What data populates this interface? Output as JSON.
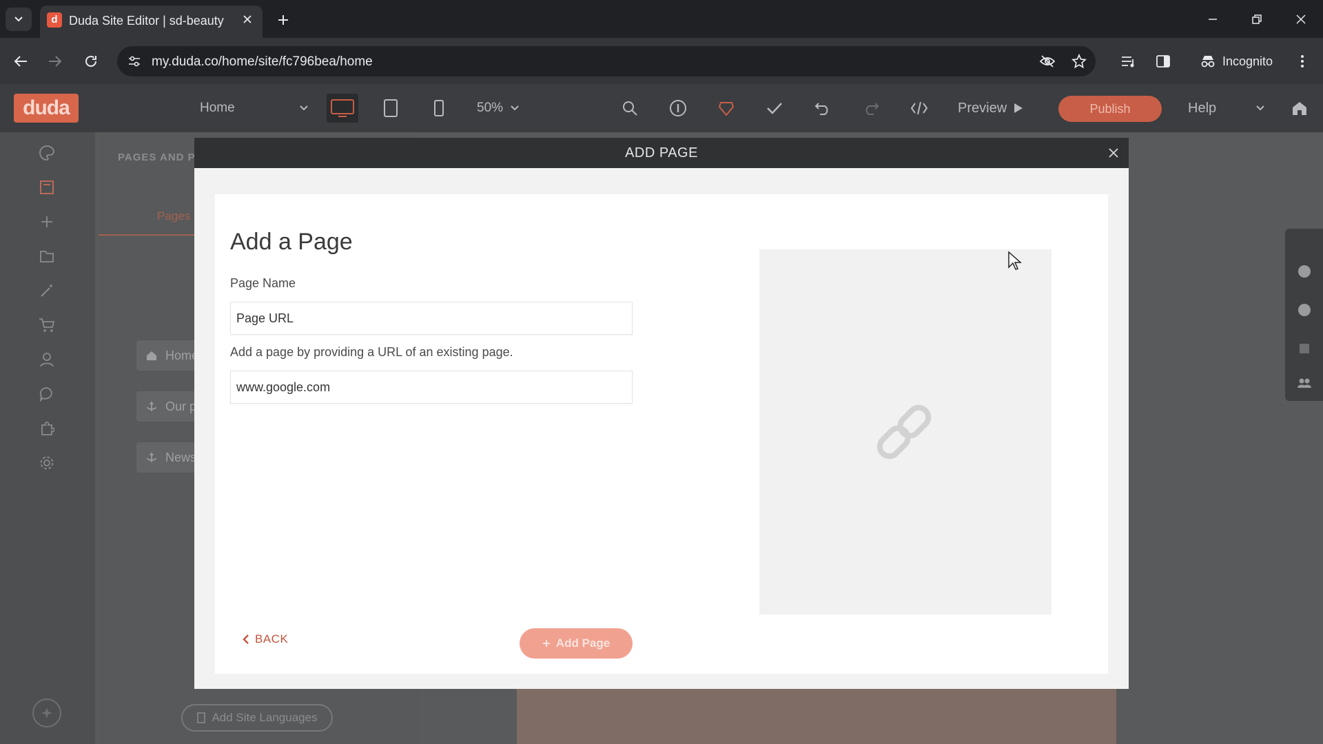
{
  "browser": {
    "tab_title": "Duda Site Editor | sd-beauty",
    "favicon_letter": "d",
    "url": "my.duda.co/home/site/fc796bea/home",
    "incognito_label": "Incognito"
  },
  "editor": {
    "logo": "duda",
    "page_selector": "Home",
    "zoom": "50%",
    "preview_label": "Preview",
    "publish_label": "Publish",
    "help_label": "Help",
    "active_device": "desktop"
  },
  "side_panel": {
    "header": "PAGES AND P",
    "tab": "Pages",
    "pages": [
      "Home",
      "Our p",
      "News"
    ],
    "add_languages": "Add Site Languages"
  },
  "modal": {
    "title": "ADD PAGE",
    "heading": "Add a Page",
    "page_name_label": "Page Name",
    "page_name_value": "Page URL",
    "help_text": "Add a page by providing a URL of an existing page.",
    "url_value": "www.google.com",
    "back_label": "BACK",
    "add_page_label": "Add Page"
  },
  "colors": {
    "brand": "#d8664b",
    "link": "#c0553d",
    "button_disabled": "#f1a18f"
  }
}
